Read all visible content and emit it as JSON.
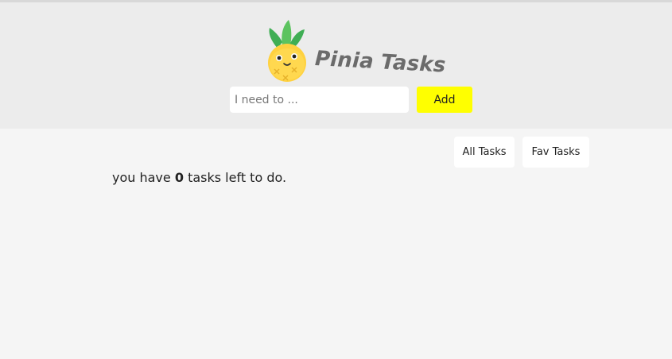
{
  "header": {
    "title": "Pinia Tasks",
    "logo": "pinia-pineapple-logo"
  },
  "new_task_form": {
    "placeholder": "I need to ...",
    "value": "",
    "add_label": "Add"
  },
  "filter": {
    "all_label": "All Tasks",
    "fav_label": "Fav Tasks"
  },
  "summary": {
    "prefix": "you have",
    "count": "0",
    "suffix": "tasks left to do."
  },
  "colors": {
    "header_bg": "#ececec",
    "page_bg": "#f5f5f5",
    "add_button": "#ffff00",
    "title_text": "#6b6b6b"
  }
}
